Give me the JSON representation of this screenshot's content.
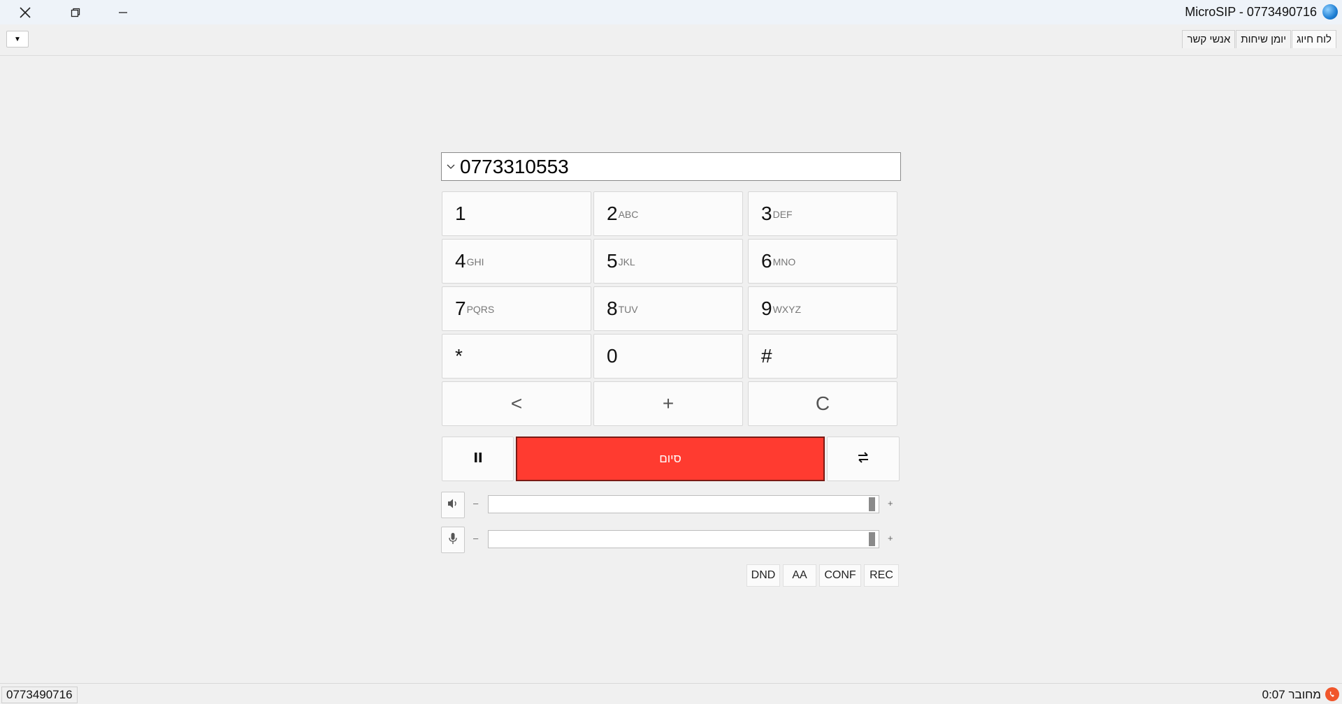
{
  "window": {
    "title": "MicroSIP - 0773490716"
  },
  "toolbar": {
    "tabs": [
      {
        "label": "לוח חיוג"
      },
      {
        "label": "יומן שיחות"
      },
      {
        "label": "אנשי קשר"
      }
    ]
  },
  "dialer": {
    "number": "0773310553",
    "keys": [
      {
        "digit": "1",
        "letters": ""
      },
      {
        "digit": "2",
        "letters": "ABC"
      },
      {
        "digit": "3",
        "letters": "DEF"
      },
      {
        "digit": "4",
        "letters": "GHI"
      },
      {
        "digit": "5",
        "letters": "JKL"
      },
      {
        "digit": "6",
        "letters": "MNO"
      },
      {
        "digit": "7",
        "letters": "PQRS"
      },
      {
        "digit": "8",
        "letters": "TUV"
      },
      {
        "digit": "9",
        "letters": "WXYZ"
      },
      {
        "digit": "*",
        "letters": ""
      },
      {
        "digit": "0",
        "letters": ""
      },
      {
        "digit": "#",
        "letters": ""
      }
    ],
    "backspace_label": "<",
    "plus_label": "+",
    "clear_label": "C",
    "end_call_label": "סיום",
    "speaker": {
      "minus": "–",
      "plus": "+",
      "level": 0.99
    },
    "microphone": {
      "minus": "–",
      "plus": "+",
      "level": 0.99
    },
    "options": [
      {
        "label": "DND"
      },
      {
        "label": "AA"
      },
      {
        "label": "CONF"
      },
      {
        "label": "REC"
      }
    ]
  },
  "status": {
    "account": "0773490716",
    "state": "מחובר",
    "timer": "0:07",
    "status_color": "#f0562b"
  },
  "colors": {
    "end_call": "#ff3b30"
  }
}
